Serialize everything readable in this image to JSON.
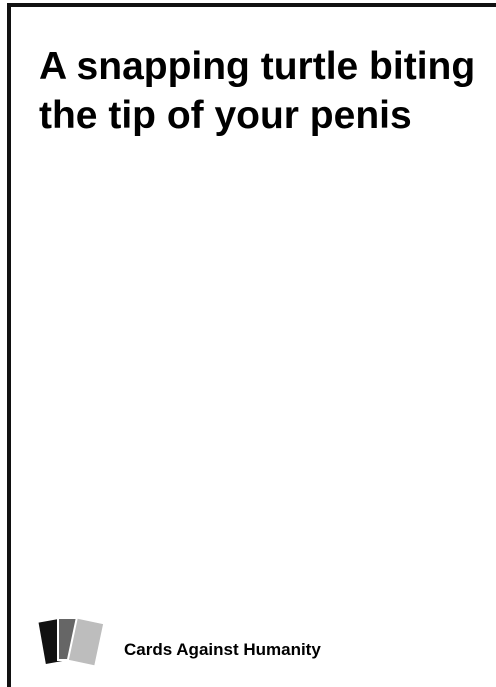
{
  "card": {
    "text": "A snapping turtle biting the tip of your penis",
    "brand": "Cards Against Humanity"
  },
  "colors": {
    "card_background": "#ffffff",
    "text": "#000000",
    "border": "#111111",
    "logo_card_back": "#111111",
    "logo_card_middle": "#666666",
    "logo_card_front": "#bdbdbd"
  },
  "icons": {
    "logo": "stacked-cards-logo"
  }
}
